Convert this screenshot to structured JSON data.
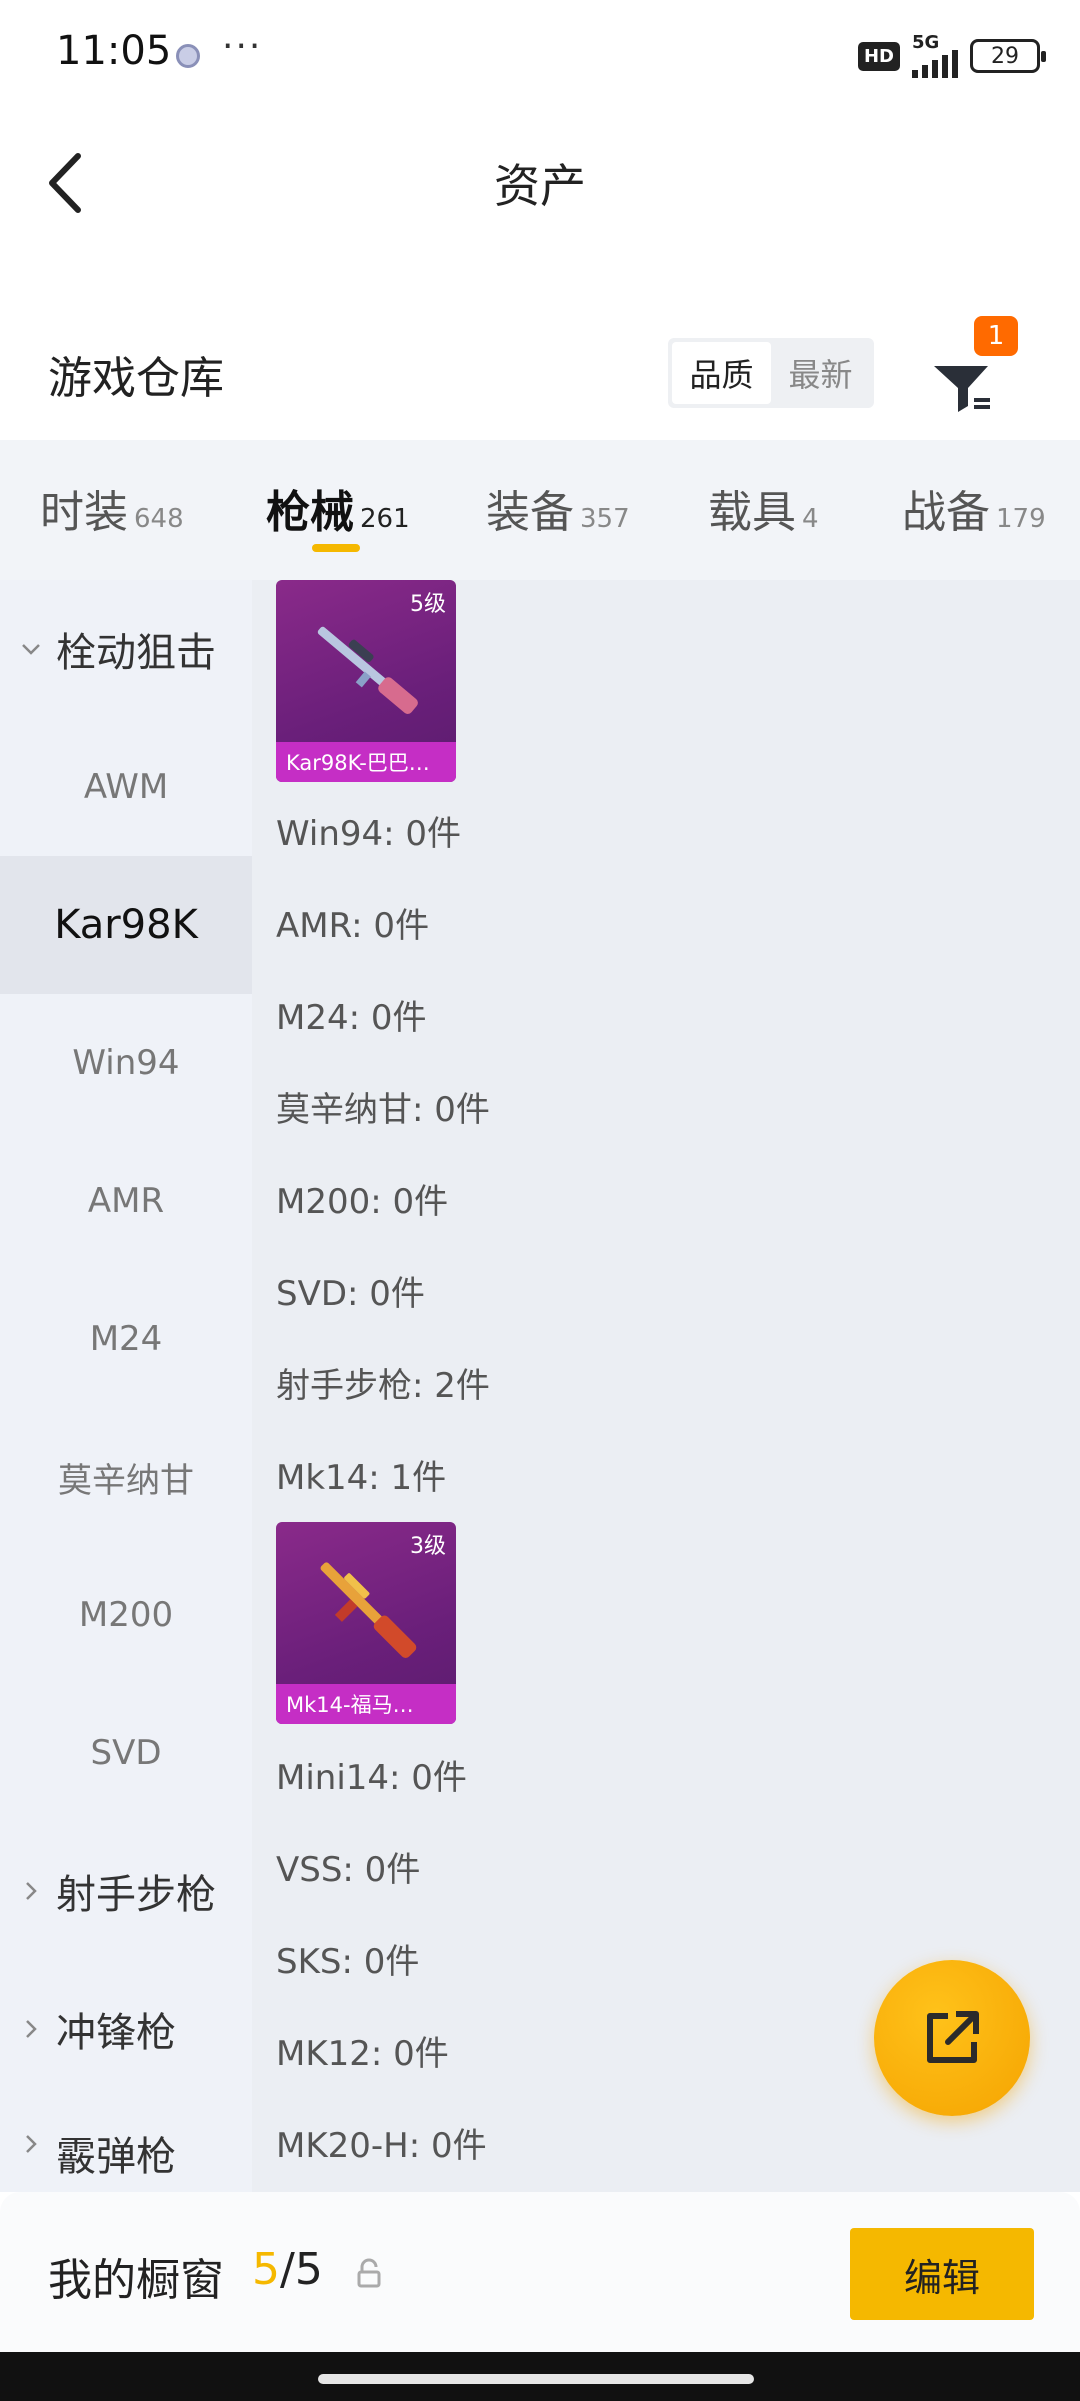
{
  "status_bar": {
    "time": "11:05",
    "more": "···",
    "hd": "HD",
    "network": "5G",
    "battery": "29"
  },
  "nav": {
    "title": "资产"
  },
  "warehouse": {
    "title": "游戏仓库",
    "sort_options": [
      "品质",
      "最新"
    ],
    "active_sort": "品质",
    "filter_badge": "1"
  },
  "tabs": [
    {
      "label": "时装",
      "count": "648",
      "active": false
    },
    {
      "label": "枪械",
      "count": "261",
      "active": true
    },
    {
      "label": "装备",
      "count": "357",
      "active": false
    },
    {
      "label": "载具",
      "count": "4",
      "active": false
    },
    {
      "label": "战备",
      "count": "179",
      "active": false
    }
  ],
  "sidebar": {
    "items": [
      {
        "label": "栓动狙击",
        "type": "group",
        "expanded": true
      },
      {
        "label": "AWM"
      },
      {
        "label": "Kar98K",
        "active": true
      },
      {
        "label": "Win94"
      },
      {
        "label": "AMR"
      },
      {
        "label": "M24"
      },
      {
        "label": "莫辛纳甘"
      },
      {
        "label": "M200"
      },
      {
        "label": "SVD"
      },
      {
        "label": "射手步枪",
        "type": "group",
        "expanded": false
      },
      {
        "label": "冲锋枪",
        "type": "group",
        "expanded": false
      },
      {
        "label": "霰弹枪",
        "type": "group",
        "expanded": false
      }
    ]
  },
  "content": {
    "cards": [
      {
        "level": "5级",
        "name": "Kar98K-巴巴…"
      },
      {
        "level": "3级",
        "name": "Mk14-福马…"
      }
    ],
    "rows": [
      "Win94: 0件",
      "AMR: 0件",
      "M24: 0件",
      "莫辛纳甘: 0件",
      "M200: 0件",
      "SVD: 0件",
      "射手步枪: 2件",
      "Mk14: 1件",
      "Mini14: 0件",
      "VSS: 0件",
      "SKS: 0件",
      "MK12: 0件",
      "MK20-H: 0件"
    ]
  },
  "bottom": {
    "showcase_label": "我的橱窗",
    "current": "5",
    "separator": "/",
    "total": "5",
    "edit_label": "编辑"
  },
  "colors": {
    "accent": "#f5b800",
    "badge": "#ff6a00",
    "card_purple": "#6a1f7a",
    "card_label": "#c52ec5"
  }
}
